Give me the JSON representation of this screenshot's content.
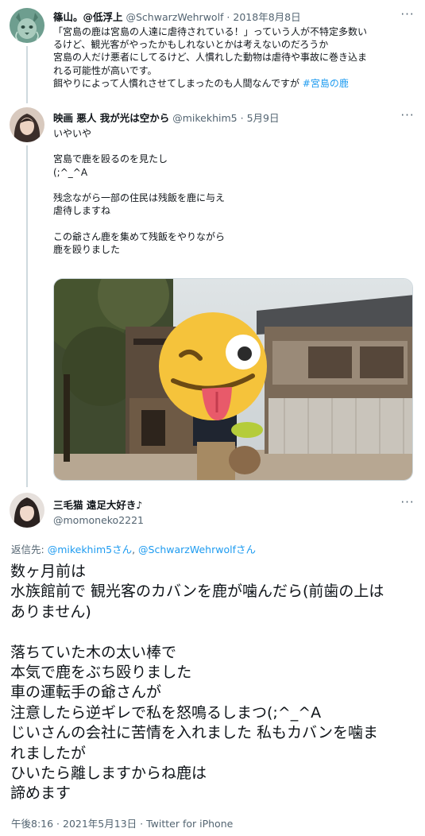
{
  "tweet1": {
    "name": "篠山。@低浮上",
    "handle": "@SchwarzWehrwolf",
    "sep": "·",
    "time": "2018年8月8日",
    "lines": [
      "「宮島の鹿は宮島の人達に虐待されている！」っていう人が不特定多数い",
      "るけど、観光客がやったかもしれないとかは考えないのだろうか",
      "宮島の人だけ悪者にしてるけど、人慣れした動物は虐待や事故に巻き込ま",
      "れる可能性が高いです。"
    ],
    "last_line": "餌やりによって人慣れさせてしまったのも人間なんですが ",
    "hashtag": "#宮島の鹿",
    "more_icon": "more-horizontal-icon"
  },
  "tweet2": {
    "name": "映画 悪人 我が光は空から",
    "handle": "@mikekhim5",
    "sep": "·",
    "time": "5月9日",
    "text": "いやいや\n\n宮島で鹿を殴るのを見たし\n(;^_^A\n\n残念ながら一部の住民は残飯を鹿に与え\n虐待しますね\n\nこの爺さん鹿を集めて残飯をやりながら\n鹿を殴りました",
    "image_desc": "photo-with-winking-emoji"
  },
  "tweet3": {
    "name": "三毛猫 遠足大好き♪",
    "handle": "@momoneko2221",
    "reply_prefix": "返信先: ",
    "reply_to_1": "@mikekhim5さん",
    "reply_sep": ", ",
    "reply_to_2": "@SchwarzWehrwolfさん",
    "text": "数ヶ月前は\n水族館前で 観光客のカバンを鹿が噛んだら(前歯の上は\nありません)\n\n落ちていた木の太い棒で\n本気で鹿をぶち殴りました\n車の運転手の爺さんが\n注意したら逆ギレで私を怒鳴るしまつ(;^_^A\nじいさんの会社に苦情を入れました 私もカバンを噛ま\nれましたが\nひいたら離しますからね鹿は\n諦めます",
    "meta": "午後8:16 · 2021年5月13日 · Twitter for iPhone"
  },
  "colors": {
    "link": "#1d9bf0",
    "secondary": "#536471",
    "line": "#cfd9de"
  }
}
